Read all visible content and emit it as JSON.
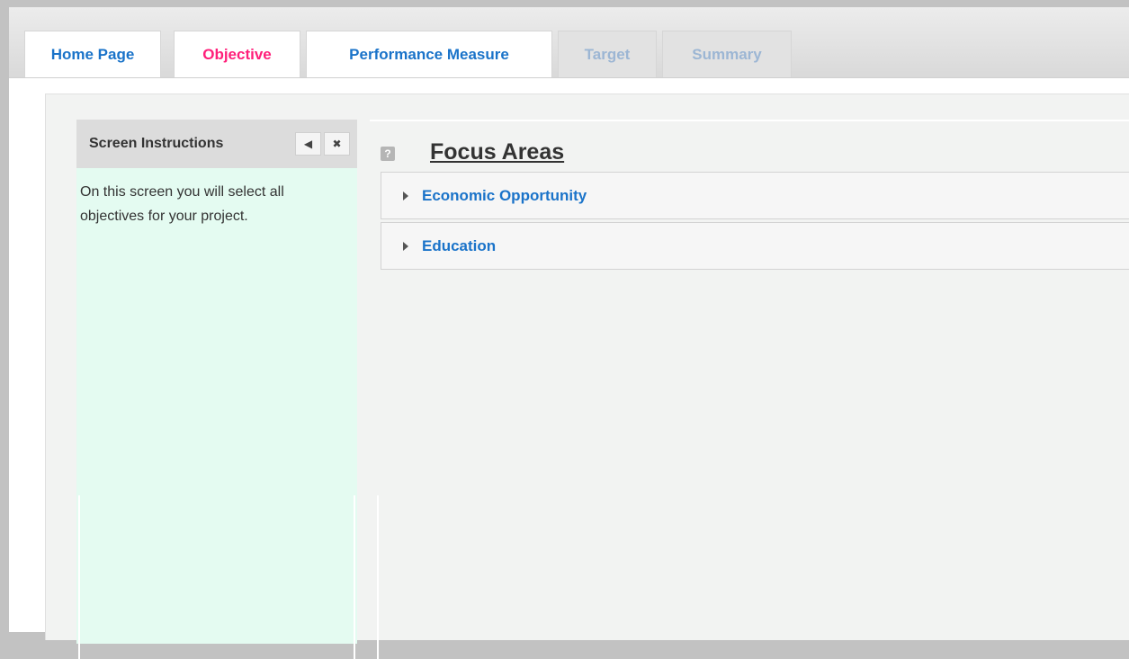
{
  "tabs": [
    {
      "label": "Home Page",
      "state": "normal"
    },
    {
      "label": "Objective",
      "state": "active"
    },
    {
      "label": "Performance Measure",
      "state": "normal"
    },
    {
      "label": "Target",
      "state": "disabled"
    },
    {
      "label": "Summary",
      "state": "disabled"
    }
  ],
  "instructions": {
    "title": "Screen Instructions",
    "collapse_icon": "triangle-left-icon",
    "close_icon": "close-x-icon",
    "text": "On this screen you will select all objectives for your project."
  },
  "focus": {
    "help_icon": "?",
    "title": "Focus Areas",
    "items": [
      {
        "label": "Economic Opportunity"
      },
      {
        "label": "Education"
      }
    ]
  },
  "colors": {
    "tab_link": "#1a73c9",
    "tab_active": "#ff1f7a",
    "tab_disabled": "#9cb6d4",
    "instructions_bg": "#e4fbf1"
  }
}
